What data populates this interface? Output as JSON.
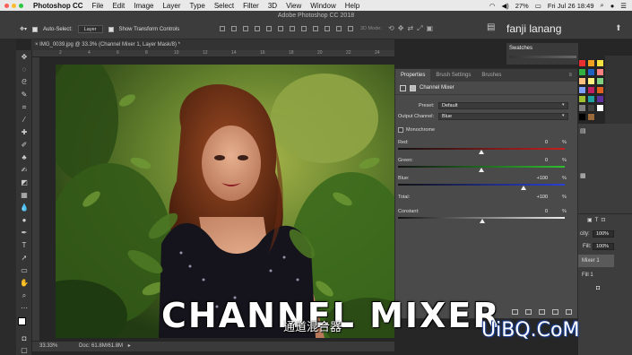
{
  "menubar": {
    "apple": "",
    "app": "Photoshop CC",
    "items": [
      "File",
      "Edit",
      "Image",
      "Layer",
      "Type",
      "Select",
      "Filter",
      "3D",
      "View",
      "Window",
      "Help"
    ],
    "battery": "27%",
    "datetime": "Fri Jul 26  18:49"
  },
  "window": {
    "title": "Adobe Photoshop CC 2018"
  },
  "options": {
    "auto_select_label": "Auto-Select:",
    "auto_select_value": "Layer",
    "transform_label": "Show Transform Controls",
    "mode_3d": "3D Mode:",
    "workspace_user": "fanji lanang"
  },
  "document": {
    "tab": "IMG_0039.jpg @ 33.3% (Channel Mixer 1, Layer Mask/8) *",
    "zoom": "33.33%",
    "doc_info": "Doc: 61.8M/61.8M",
    "ruler_ticks": [
      "2",
      "4",
      "6",
      "8",
      "10",
      "12",
      "14",
      "16",
      "18",
      "20",
      "22",
      "24"
    ]
  },
  "properties": {
    "tabs": [
      "Properties",
      "Brush Settings",
      "Brushes"
    ],
    "header": "Channel Mixer",
    "preset_label": "Preset:",
    "preset_value": "Default",
    "output_label": "Output Channel:",
    "output_value": "Blue",
    "monochrome_label": "Monochrome",
    "sliders": [
      {
        "label": "Red:",
        "value": "0",
        "percent": 0
      },
      {
        "label": "Green:",
        "value": "0",
        "percent": 0
      },
      {
        "label": "Blue:",
        "value": "+100",
        "percent": 100
      }
    ],
    "total_label": "Total:",
    "total_value": "+100",
    "constant_label": "Constant:",
    "constant_value": "0",
    "pct": "%"
  },
  "swatches": {
    "title": "Swatches",
    "colors": [
      "#e83030",
      "#f0a020",
      "#f4e040",
      "#30b040",
      "#2060c0",
      "#ff8080",
      "#ffc080",
      "#fff080",
      "#80d080",
      "#80a0ff",
      "#c02060",
      "#e06020",
      "#a0c030",
      "#20a0a0",
      "#6030a0",
      "#808080",
      "#404040",
      "#ffffff",
      "#000000",
      "#9a6a3a"
    ]
  },
  "layers": {
    "opacity_label": "city:",
    "opacity_value": "100%",
    "fill_label": "Fill:",
    "fill_value": "100%",
    "layer1": "Mixer 1",
    "layer2": "Fill 1"
  },
  "overlay": {
    "title": "CHANNEL MIXER",
    "subtitle": "通道混合器",
    "watermark": "UiBQ.CoM"
  },
  "colors": {
    "accent": "#2d8ceb",
    "panel": "#4a4a4a",
    "background": "#262626"
  }
}
